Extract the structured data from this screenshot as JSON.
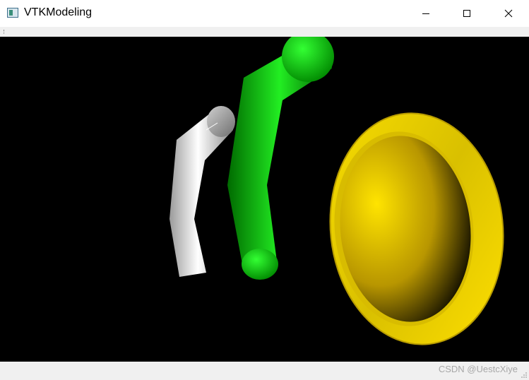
{
  "window": {
    "title": "VTKModeling",
    "icon": "vtk-app-icon"
  },
  "controls": {
    "minimize_icon": "minimize-icon",
    "maximize_icon": "maximize-icon",
    "close_icon": "close-icon"
  },
  "viewport": {
    "background": "#000000",
    "objects": [
      {
        "name": "white-tube",
        "color": "#e0e0e0"
      },
      {
        "name": "green-tube",
        "color": "#00d000"
      },
      {
        "name": "yellow-ring-bowl",
        "color": "#f2d600"
      }
    ]
  },
  "statusbar": {
    "watermark": "CSDN @UestcXiye"
  }
}
